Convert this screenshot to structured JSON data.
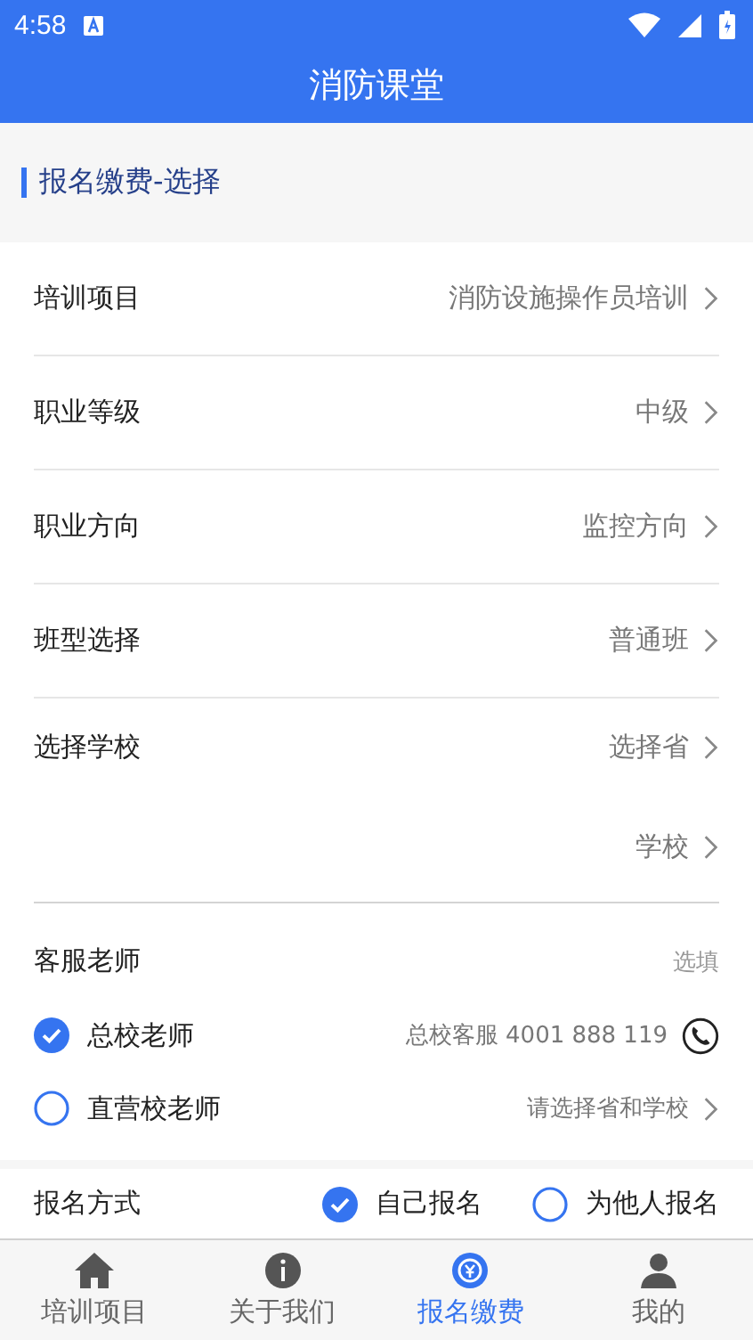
{
  "status_bar": {
    "time": "4:58"
  },
  "header": {
    "title": "消防课堂"
  },
  "section": {
    "title": "报名缴费-选择"
  },
  "rows": [
    {
      "label": "培训项目",
      "value": "消防设施操作员培训"
    },
    {
      "label": "职业等级",
      "value": "中级"
    },
    {
      "label": "职业方向",
      "value": "监控方向"
    },
    {
      "label": "班型选择",
      "value": "普通班"
    }
  ],
  "school": {
    "label": "选择学校",
    "province": "选择省",
    "school": "学校"
  },
  "teacher": {
    "label": "客服老师",
    "hint": "选填",
    "options": [
      {
        "label": "总校老师",
        "selected": true,
        "kind": "phone",
        "note": "总校客服 4001 888 119"
      },
      {
        "label": "直营校老师",
        "selected": false,
        "kind": "select",
        "note": "请选择省和学校"
      }
    ]
  },
  "signup": {
    "label": "报名方式",
    "options": [
      {
        "label": "自己报名",
        "selected": true
      },
      {
        "label": "为他人报名",
        "selected": false
      }
    ]
  },
  "nav": [
    {
      "label": "培训项目",
      "kind": "home",
      "selected": false
    },
    {
      "label": "关于我们",
      "kind": "info",
      "selected": false
    },
    {
      "label": "报名缴费",
      "kind": "pay",
      "selected": true
    },
    {
      "label": "我的",
      "kind": "user",
      "selected": false
    }
  ]
}
